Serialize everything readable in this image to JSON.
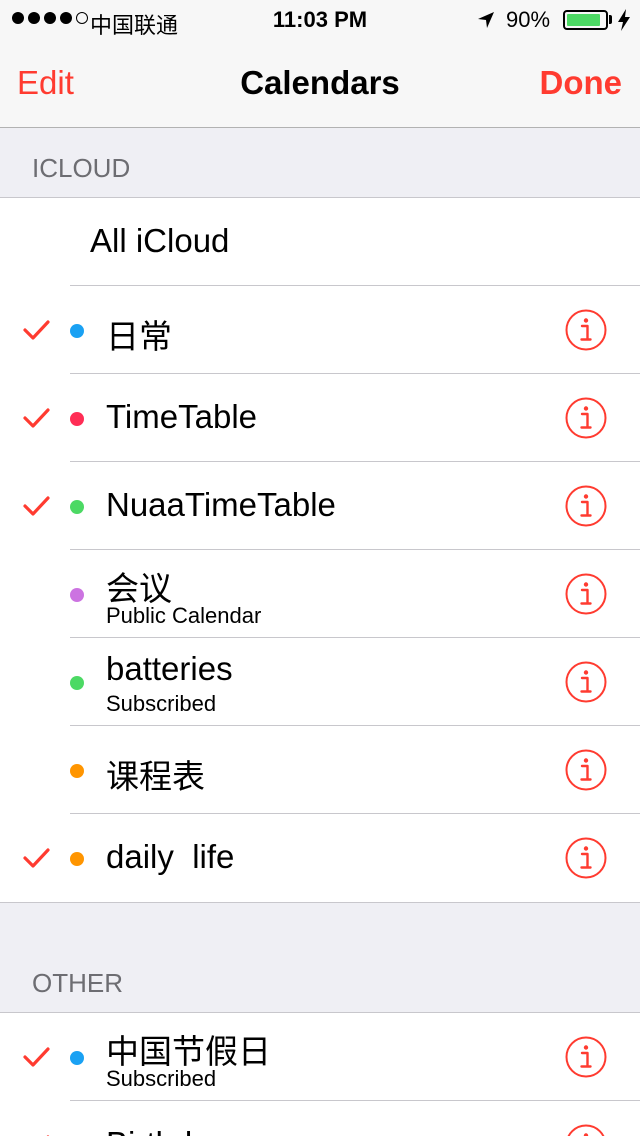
{
  "status_bar": {
    "carrier": "中国联通",
    "time": "11:03 PM",
    "battery_percent": "90%",
    "battery_level": 0.9,
    "signal_bars": 4,
    "icons": [
      "location-arrow-icon",
      "battery-icon",
      "charging-bolt-icon"
    ]
  },
  "nav": {
    "edit_label": "Edit",
    "title": "Calendars",
    "done_label": "Done"
  },
  "colors": {
    "accent": "#ff3b30",
    "background": "#efeff4"
  },
  "sections": {
    "icloud": {
      "header": "ICLOUD",
      "all_label": "All iCloud",
      "items": [
        {
          "name": "日常",
          "subtitle": "",
          "checked": true,
          "color": "#1aa1f3"
        },
        {
          "name": "TimeTable",
          "subtitle": "",
          "checked": true,
          "color": "#ff2d55"
        },
        {
          "name": "NuaaTimeTable",
          "subtitle": "",
          "checked": true,
          "color": "#4cd964"
        },
        {
          "name": "会议",
          "subtitle": "Public Calendar",
          "checked": false,
          "color": "#cc73e1"
        },
        {
          "name": "batteries",
          "subtitle": "Subscribed",
          "checked": false,
          "color": "#4cd964"
        },
        {
          "name": "课程表",
          "subtitle": "",
          "checked": false,
          "color": "#ff9500"
        },
        {
          "name": "daily  life",
          "subtitle": "",
          "checked": true,
          "color": "#ff9500"
        }
      ]
    },
    "other": {
      "header": "OTHER",
      "items": [
        {
          "name": "中国节假日",
          "subtitle": "Subscribed",
          "checked": true,
          "color": "#1aa1f3"
        },
        {
          "name": "Birthdays",
          "subtitle": "",
          "checked": true,
          "color": "#ff3b30"
        }
      ]
    }
  }
}
